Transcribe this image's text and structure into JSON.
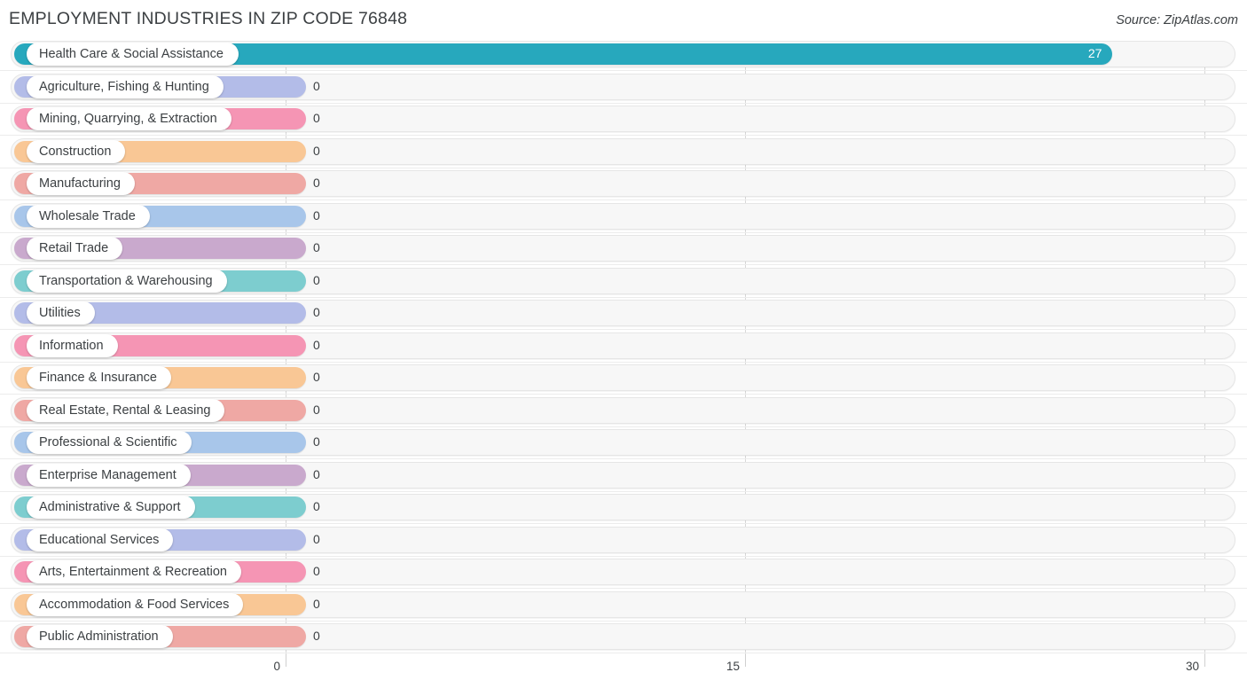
{
  "header": {
    "title": "EMPLOYMENT INDUSTRIES IN ZIP CODE 76848",
    "source": "Source: ZipAtlas.com"
  },
  "chart_data": {
    "type": "bar",
    "orientation": "horizontal",
    "title": "EMPLOYMENT INDUSTRIES IN ZIP CODE 76848",
    "xlabel": "",
    "ylabel": "",
    "xlim": [
      0,
      30
    ],
    "xticks": [
      "0",
      "15",
      "30"
    ],
    "xtick_values": [
      0,
      15,
      30
    ],
    "grid": true,
    "legend": false,
    "categories": [
      "Health Care & Social Assistance",
      "Agriculture, Fishing & Hunting",
      "Mining, Quarrying, & Extraction",
      "Construction",
      "Manufacturing",
      "Wholesale Trade",
      "Retail Trade",
      "Transportation & Warehousing",
      "Utilities",
      "Information",
      "Finance & Insurance",
      "Real Estate, Rental & Leasing",
      "Professional & Scientific",
      "Enterprise Management",
      "Administrative & Support",
      "Educational Services",
      "Arts, Entertainment & Recreation",
      "Accommodation & Food Services",
      "Public Administration"
    ],
    "values": [
      27,
      0,
      0,
      0,
      0,
      0,
      0,
      0,
      0,
      0,
      0,
      0,
      0,
      0,
      0,
      0,
      0,
      0,
      0
    ],
    "value_labels": [
      "27",
      "0",
      "0",
      "0",
      "0",
      "0",
      "0",
      "0",
      "0",
      "0",
      "0",
      "0",
      "0",
      "0",
      "0",
      "0",
      "0",
      "0",
      "0"
    ],
    "colors": [
      "#27a8bd",
      "#b3bce8",
      "#f595b4",
      "#f9c795",
      "#efa8a4",
      "#a8c6ea",
      "#c9a9cd",
      "#7dcdcf",
      "#b3bce8",
      "#f595b4",
      "#f9c795",
      "#efa8a4",
      "#a8c6ea",
      "#c9a9cd",
      "#7dcdcf",
      "#b3bce8",
      "#f595b4",
      "#f9c795",
      "#efa8a4"
    ]
  }
}
